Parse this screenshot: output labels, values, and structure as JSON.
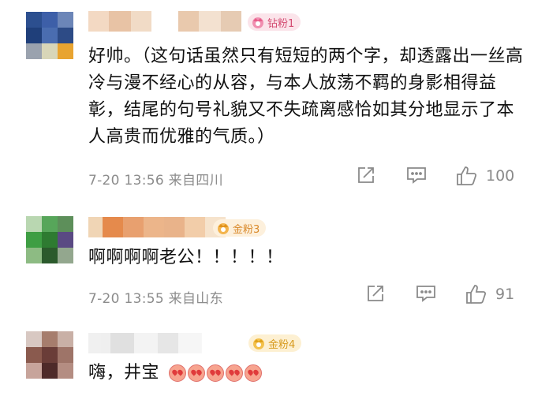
{
  "comments": [
    {
      "badge": "钻粉1",
      "text": "好帅。（这句话虽然只有短短的两个字，却透露出一丝高冷与漫不经心的从容，与本人放荡不羁的身影相得益彰，结尾的句号礼貌又不失疏离感恰如其分地显示了本人高贵而优雅的气质。）",
      "meta": "7-20 13:56  来自四川",
      "likes": "100",
      "avatar_colors": [
        "#2c4f8f",
        "#3d5fa8",
        "#6c86b8",
        "#1f3f7a",
        "#4a6db0",
        "#2d4b86",
        "#9aa2ae",
        "#d8d6b8",
        "#e8a430"
      ],
      "name_colors": [
        "#f3d9c3",
        "#e8c3a5",
        "#f1dbc6",
        "#ffffff",
        "#e9c9ad",
        "#f3e1d0",
        "#e6cbb3"
      ],
      "badge_bg": "#fbe4ea",
      "badge_color": "#d34a70"
    },
    {
      "badge": "金粉3",
      "text": "啊啊啊啊老公！！！！！",
      "meta": "7-20 13:55  来自山东",
      "likes": "91",
      "avatar_colors": [
        "#b9d7b1",
        "#57a65a",
        "#5d8f5a",
        "#3e9e43",
        "#2e7b31",
        "#5a4a83",
        "#8dbb83",
        "#2b5a2c",
        "#93a78e"
      ],
      "name_colors": [
        "#f0d5b5",
        "#e58a4c",
        "#e8a06f",
        "#ecb58a",
        "#e9b38a",
        "#f2cda9",
        "#f6e3cc"
      ],
      "badge_bg": "#fdf0dc",
      "badge_color": "#d9892a"
    },
    {
      "badge": "金粉4",
      "text": "嗨，井宝",
      "meta": "",
      "likes": "",
      "avatar_colors": [
        "#d8c8c2",
        "#a67d6d",
        "#c9b0a6",
        "#8a5a4e",
        "#6a3d38",
        "#9e7468",
        "#c7a49b",
        "#4e2a29",
        "#b48d82"
      ],
      "name_colors": [
        "#eeeeee",
        "#dddddd",
        "#f2f2f2",
        "#e4e4e4",
        "#f6f6f6"
      ],
      "badge_bg": "#fdf0d2",
      "badge_color": "#d79a1e",
      "emoji_count": 5
    }
  ],
  "icons": [
    "share-icon",
    "comment-icon",
    "like-icon"
  ]
}
